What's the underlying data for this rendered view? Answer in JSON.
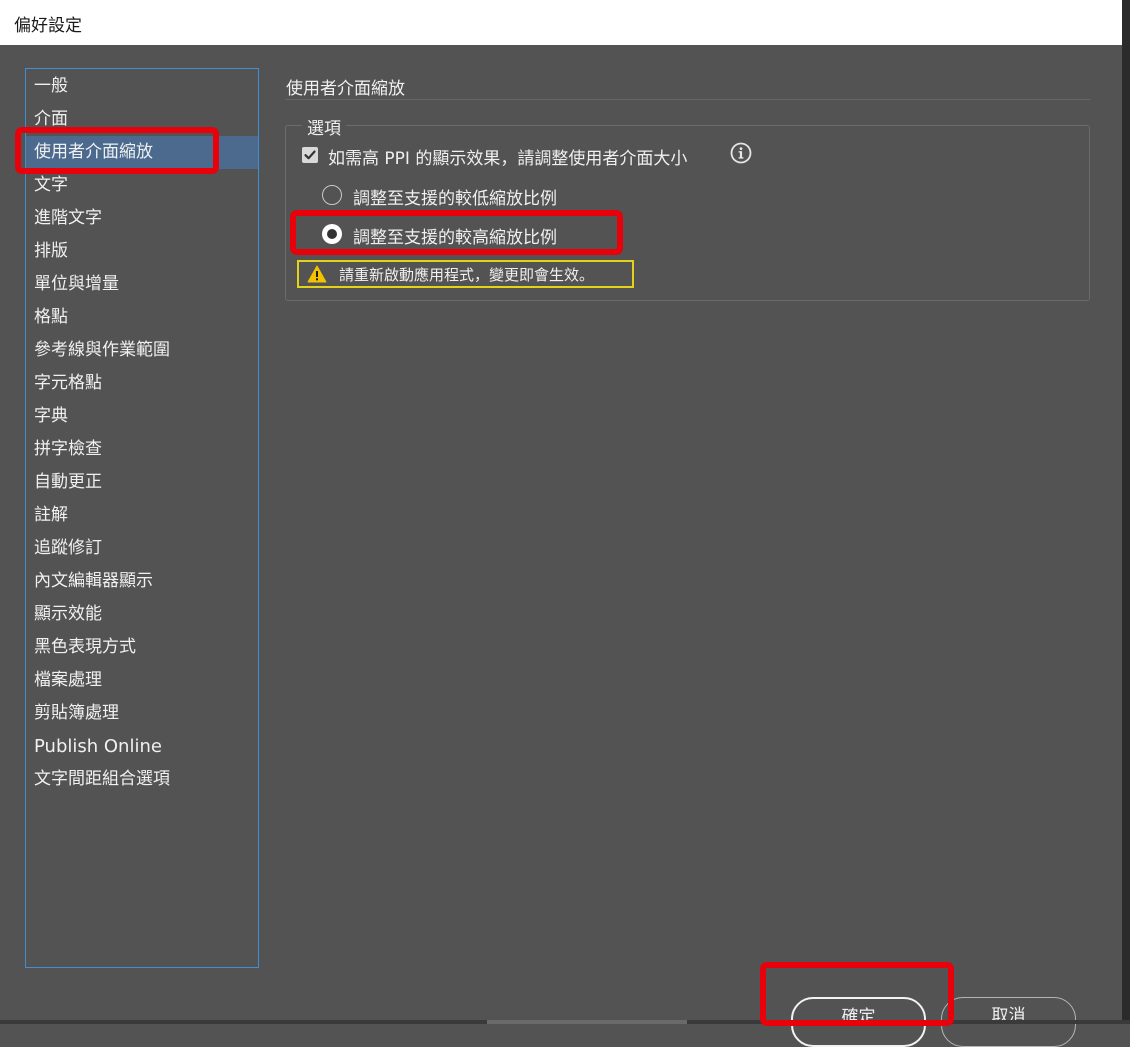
{
  "window": {
    "title": "偏好設定"
  },
  "sidebar": {
    "items": [
      {
        "label": "一般"
      },
      {
        "label": "介面"
      },
      {
        "label": "使用者介面縮放",
        "selected": true
      },
      {
        "label": "文字"
      },
      {
        "label": "進階文字"
      },
      {
        "label": "排版"
      },
      {
        "label": "單位與增量"
      },
      {
        "label": "格點"
      },
      {
        "label": "參考線與作業範圍"
      },
      {
        "label": "字元格點"
      },
      {
        "label": "字典"
      },
      {
        "label": "拼字檢查"
      },
      {
        "label": "自動更正"
      },
      {
        "label": "註解"
      },
      {
        "label": "追蹤修訂"
      },
      {
        "label": "內文編輯器顯示"
      },
      {
        "label": "顯示效能"
      },
      {
        "label": "黑色表現方式"
      },
      {
        "label": "檔案處理"
      },
      {
        "label": "剪貼簿處理"
      },
      {
        "label": "Publish Online"
      },
      {
        "label": "文字間距組合選項"
      }
    ]
  },
  "main": {
    "section_title": "使用者介面縮放",
    "options_group_label": "選項",
    "checkbox_label": "如需高 PPI 的顯示效果，請調整使用者介面大小",
    "checkbox_checked": true,
    "radio_low_label": "調整至支援的較低縮放比例",
    "radio_high_label": "調整至支援的較高縮放比例",
    "radio_selected": "high",
    "warning_text": "請重新啟動應用程式，變更即會生效。"
  },
  "buttons": {
    "ok_label": "確定",
    "cancel_label": "取消"
  },
  "colors": {
    "background": "#535353",
    "selection": "#4b6a8e",
    "sidebar_border": "#3d8fd6",
    "highlight_annotation": "#e8000b",
    "warning_border": "#e3d21a"
  },
  "icons": {
    "checkbox_check": "checkmark-icon",
    "info": "info-icon",
    "warning": "warning-triangle-icon"
  }
}
